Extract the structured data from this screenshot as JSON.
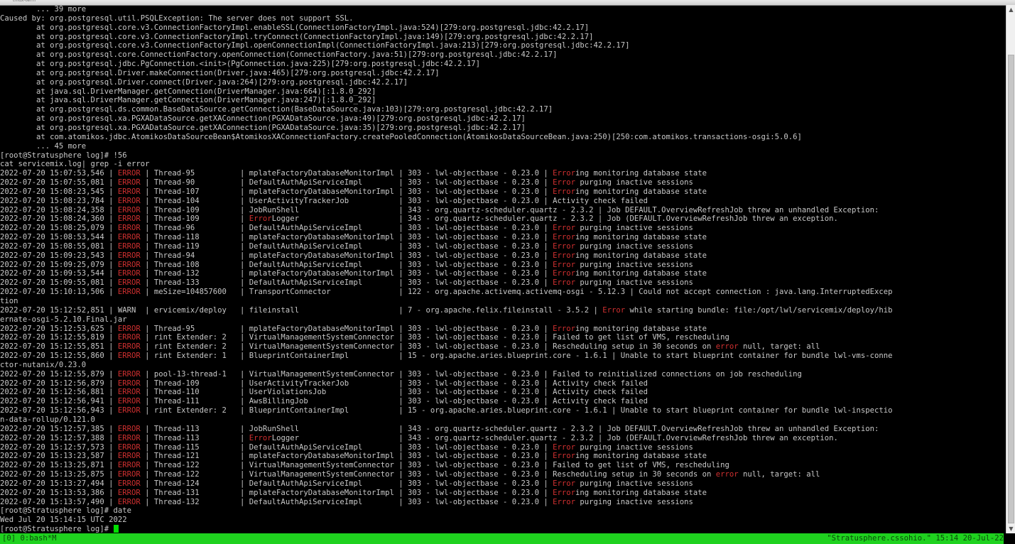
{
  "window": {
    "title": "tmux-term"
  },
  "terminal": {
    "lines": [
      {
        "segments": [
          {
            "text": "        ... 39 more"
          }
        ]
      },
      {
        "segments": [
          {
            "text": "Caused by: org.postgresql.util.PSQLException: The server does not support SSL."
          }
        ]
      },
      {
        "segments": [
          {
            "text": "        at org.postgresql.core.v3.ConnectionFactoryImpl.enableSSL(ConnectionFactoryImpl.java:524)[279:org.postgresql.jdbc:42.2.17]"
          }
        ]
      },
      {
        "segments": [
          {
            "text": "        at org.postgresql.core.v3.ConnectionFactoryImpl.tryConnect(ConnectionFactoryImpl.java:149)[279:org.postgresql.jdbc:42.2.17]"
          }
        ]
      },
      {
        "segments": [
          {
            "text": "        at org.postgresql.core.v3.ConnectionFactoryImpl.openConnectionImpl(ConnectionFactoryImpl.java:213)[279:org.postgresql.jdbc:42.2.17]"
          }
        ]
      },
      {
        "segments": [
          {
            "text": "        at org.postgresql.core.ConnectionFactory.openConnection(ConnectionFactory.java:51)[279:org.postgresql.jdbc:42.2.17]"
          }
        ]
      },
      {
        "segments": [
          {
            "text": "        at org.postgresql.jdbc.PgConnection.<init>(PgConnection.java:225)[279:org.postgresql.jdbc:42.2.17]"
          }
        ]
      },
      {
        "segments": [
          {
            "text": "        at org.postgresql.Driver.makeConnection(Driver.java:465)[279:org.postgresql.jdbc:42.2.17]"
          }
        ]
      },
      {
        "segments": [
          {
            "text": "        at org.postgresql.Driver.connect(Driver.java:264)[279:org.postgresql.jdbc:42.2.17]"
          }
        ]
      },
      {
        "segments": [
          {
            "text": "        at java.sql.DriverManager.getConnection(DriverManager.java:664)[:1.8.0_292]"
          }
        ]
      },
      {
        "segments": [
          {
            "text": "        at java.sql.DriverManager.getConnection(DriverManager.java:247)[:1.8.0_292]"
          }
        ]
      },
      {
        "segments": [
          {
            "text": "        at org.postgresql.ds.common.BaseDataSource.getConnection(BaseDataSource.java:103)[279:org.postgresql.jdbc:42.2.17]"
          }
        ]
      },
      {
        "segments": [
          {
            "text": "        at org.postgresql.xa.PGXADataSource.getXAConnection(PGXADataSource.java:49)[279:org.postgresql.jdbc:42.2.17]"
          }
        ]
      },
      {
        "segments": [
          {
            "text": "        at org.postgresql.xa.PGXADataSource.getXAConnection(PGXADataSource.java:35)[279:org.postgresql.jdbc:42.2.17]"
          }
        ]
      },
      {
        "segments": [
          {
            "text": "        at com.atomikos.jdbc.AtomikosDataSourceBean$AtomikosXAConnectionFactory.createPooledConnection(AtomikosDataSourceBean.java:250)[250:com.atomikos.transactions-osgi:5.0.6]"
          }
        ]
      },
      {
        "segments": [
          {
            "text": "        ... 45 more"
          }
        ]
      },
      {
        "segments": [
          {
            "text": "[root@Stratusphere log]# !56"
          }
        ]
      },
      {
        "segments": [
          {
            "text": "cat servicemix.log| grep -i error"
          }
        ]
      },
      {
        "segments": [
          {
            "text": "2022-07-20 15:07:53,546 | "
          },
          {
            "text": "ERROR",
            "err": true
          },
          {
            "text": " | Thread-95          | mplateFactoryDatabaseMonitorImpl | 303 - lwl-objectbase - 0.23.0 | "
          },
          {
            "text": "Error",
            "err": true
          },
          {
            "text": "ing monitoring database state"
          }
        ]
      },
      {
        "segments": [
          {
            "text": "2022-07-20 15:07:55,081 | "
          },
          {
            "text": "ERROR",
            "err": true
          },
          {
            "text": " | Thread-90          | DefaultAuthApiServiceImpl        | 303 - lwl-objectbase - 0.23.0 | "
          },
          {
            "text": "Error",
            "err": true
          },
          {
            "text": " purging inactive sessions"
          }
        ]
      },
      {
        "segments": [
          {
            "text": "2022-07-20 15:08:23,545 | "
          },
          {
            "text": "ERROR",
            "err": true
          },
          {
            "text": " | Thread-107         | mplateFactoryDatabaseMonitorImpl | 303 - lwl-objectbase - 0.23.0 | "
          },
          {
            "text": "Error",
            "err": true
          },
          {
            "text": "ing monitoring database state"
          }
        ]
      },
      {
        "segments": [
          {
            "text": "2022-07-20 15:08:23,784 | "
          },
          {
            "text": "ERROR",
            "err": true
          },
          {
            "text": " | Thread-104         | UserActivityTrackerJob           | 303 - lwl-objectbase - 0.23.0 | Activity check failed"
          }
        ]
      },
      {
        "segments": [
          {
            "text": "2022-07-20 15:08:24,358 | "
          },
          {
            "text": "ERROR",
            "err": true
          },
          {
            "text": " | Thread-109         | JobRunShell                      | 343 - org.quartz-scheduler.quartz - 2.3.2 | Job DEFAULT.OverviewRefreshJob threw an unhandled Exception:"
          }
        ]
      },
      {
        "segments": [
          {
            "text": "2022-07-20 15:08:24,360 | "
          },
          {
            "text": "ERROR",
            "err": true
          },
          {
            "text": " | Thread-109         | "
          },
          {
            "text": "Error",
            "err": true
          },
          {
            "text": "Logger                      | 343 - org.quartz-scheduler.quartz - 2.3.2 | Job (DEFAULT.OverviewRefreshJob threw an exception."
          }
        ]
      },
      {
        "segments": [
          {
            "text": "2022-07-20 15:08:25,079 | "
          },
          {
            "text": "ERROR",
            "err": true
          },
          {
            "text": " | Thread-96          | DefaultAuthApiServiceImpl        | 303 - lwl-objectbase - 0.23.0 | "
          },
          {
            "text": "Error",
            "err": true
          },
          {
            "text": " purging inactive sessions"
          }
        ]
      },
      {
        "segments": [
          {
            "text": "2022-07-20 15:08:53,544 | "
          },
          {
            "text": "ERROR",
            "err": true
          },
          {
            "text": " | Thread-118         | mplateFactoryDatabaseMonitorImpl | 303 - lwl-objectbase - 0.23.0 | "
          },
          {
            "text": "Error",
            "err": true
          },
          {
            "text": "ing monitoring database state"
          }
        ]
      },
      {
        "segments": [
          {
            "text": "2022-07-20 15:08:55,081 | "
          },
          {
            "text": "ERROR",
            "err": true
          },
          {
            "text": " | Thread-119         | DefaultAuthApiServiceImpl        | 303 - lwl-objectbase - 0.23.0 | "
          },
          {
            "text": "Error",
            "err": true
          },
          {
            "text": " purging inactive sessions"
          }
        ]
      },
      {
        "segments": [
          {
            "text": "2022-07-20 15:09:23,543 | "
          },
          {
            "text": "ERROR",
            "err": true
          },
          {
            "text": " | Thread-94          | mplateFactoryDatabaseMonitorImpl | 303 - lwl-objectbase - 0.23.0 | "
          },
          {
            "text": "Error",
            "err": true
          },
          {
            "text": "ing monitoring database state"
          }
        ]
      },
      {
        "segments": [
          {
            "text": "2022-07-20 15:09:25,079 | "
          },
          {
            "text": "ERROR",
            "err": true
          },
          {
            "text": " | Thread-108         | DefaultAuthApiServiceImpl        | 303 - lwl-objectbase - 0.23.0 | "
          },
          {
            "text": "Error",
            "err": true
          },
          {
            "text": " purging inactive sessions"
          }
        ]
      },
      {
        "segments": [
          {
            "text": "2022-07-20 15:09:53,544 | "
          },
          {
            "text": "ERROR",
            "err": true
          },
          {
            "text": " | Thread-132         | mplateFactoryDatabaseMonitorImpl | 303 - lwl-objectbase - 0.23.0 | "
          },
          {
            "text": "Error",
            "err": true
          },
          {
            "text": "ing monitoring database state"
          }
        ]
      },
      {
        "segments": [
          {
            "text": "2022-07-20 15:09:55,081 | "
          },
          {
            "text": "ERROR",
            "err": true
          },
          {
            "text": " | Thread-133         | DefaultAuthApiServiceImpl        | 303 - lwl-objectbase - 0.23.0 | "
          },
          {
            "text": "Error",
            "err": true
          },
          {
            "text": " purging inactive sessions"
          }
        ]
      },
      {
        "segments": [
          {
            "text": "2022-07-20 15:10:13,506 | "
          },
          {
            "text": "ERROR",
            "err": true
          },
          {
            "text": " | meSize=104857600   | TransportConnector               | 122 - org.apache.activemq.activemq-osgi - 5.12.3 | Could not accept connection : java.lang.InterruptedExcep"
          }
        ]
      },
      {
        "segments": [
          {
            "text": "tion"
          }
        ]
      },
      {
        "segments": [
          {
            "text": "2022-07-20 15:12:52,851 | WARN  | ervicemix/deploy   | fileinstall                      | 7 - org.apache.felix.fileinstall - 3.5.2 | "
          },
          {
            "text": "Error",
            "err": true
          },
          {
            "text": " while starting bundle: file:/opt/lwl/servicemix/deploy/hib"
          }
        ]
      },
      {
        "segments": [
          {
            "text": "ernate-osgi-5.2.10.Final.jar"
          }
        ]
      },
      {
        "segments": [
          {
            "text": "2022-07-20 15:12:53,625 | "
          },
          {
            "text": "ERROR",
            "err": true
          },
          {
            "text": " | Thread-95          | mplateFactoryDatabaseMonitorImpl | 303 - lwl-objectbase - 0.23.0 | "
          },
          {
            "text": "Error",
            "err": true
          },
          {
            "text": "ing monitoring database state"
          }
        ]
      },
      {
        "segments": [
          {
            "text": "2022-07-20 15:12:55,819 | "
          },
          {
            "text": "ERROR",
            "err": true
          },
          {
            "text": " | rint Extender: 2   | VirtualManagementSystemConnector | 303 - lwl-objectbase - 0.23.0 | Failed to get list of VMS, rescheduling"
          }
        ]
      },
      {
        "segments": [
          {
            "text": "2022-07-20 15:12:55,851 | "
          },
          {
            "text": "ERROR",
            "err": true
          },
          {
            "text": " | rint Extender: 2   | VirtualManagementSystemConnector | 303 - lwl-objectbase - 0.23.0 | Rescheduling setup in 30 seconds on "
          },
          {
            "text": "error",
            "err": true
          },
          {
            "text": " null, target: all"
          }
        ]
      },
      {
        "segments": [
          {
            "text": "2022-07-20 15:12:55,860 | "
          },
          {
            "text": "ERROR",
            "err": true
          },
          {
            "text": " | rint Extender: 1   | BlueprintContainerImpl           | 15 - org.apache.aries.blueprint.core - 1.6.1 | Unable to start blueprint container for bundle lwl-vms-conne"
          }
        ]
      },
      {
        "segments": [
          {
            "text": "ctor-nutanix/0.23.0"
          }
        ]
      },
      {
        "segments": [
          {
            "text": "2022-07-20 15:12:55,879 | "
          },
          {
            "text": "ERROR",
            "err": true
          },
          {
            "text": " | pool-13-thread-1   | VirtualManagementSystemConnector | 303 - lwl-objectbase - 0.23.0 | Failed to reinitialized connections on job rescheduling"
          }
        ]
      },
      {
        "segments": [
          {
            "text": "2022-07-20 15:12:56,879 | "
          },
          {
            "text": "ERROR",
            "err": true
          },
          {
            "text": " | Thread-109         | UserActivityTrackerJob           | 303 - lwl-objectbase - 0.23.0 | Activity check failed"
          }
        ]
      },
      {
        "segments": [
          {
            "text": "2022-07-20 15:12:56,881 | "
          },
          {
            "text": "ERROR",
            "err": true
          },
          {
            "text": " | Thread-110         | UserViolationsJob                | 303 - lwl-objectbase - 0.23.0 | Activity check failed"
          }
        ]
      },
      {
        "segments": [
          {
            "text": "2022-07-20 15:12:56,941 | "
          },
          {
            "text": "ERROR",
            "err": true
          },
          {
            "text": " | Thread-111         | AwsBillingJob                    | 303 - lwl-objectbase - 0.23.0 | Activity check failed"
          }
        ]
      },
      {
        "segments": [
          {
            "text": "2022-07-20 15:12:56,943 | "
          },
          {
            "text": "ERROR",
            "err": true
          },
          {
            "text": " | rint Extender: 2   | BlueprintContainerImpl           | 15 - org.apache.aries.blueprint.core - 1.6.1 | Unable to start blueprint container for bundle lwl-inspectio"
          }
        ]
      },
      {
        "segments": [
          {
            "text": "n-data-rollup/0.121.0"
          }
        ]
      },
      {
        "segments": [
          {
            "text": "2022-07-20 15:12:57,385 | "
          },
          {
            "text": "ERROR",
            "err": true
          },
          {
            "text": " | Thread-113         | JobRunShell                      | 343 - org.quartz-scheduler.quartz - 2.3.2 | Job DEFAULT.OverviewRefreshJob threw an unhandled Exception:"
          }
        ]
      },
      {
        "segments": [
          {
            "text": "2022-07-20 15:12:57,388 | "
          },
          {
            "text": "ERROR",
            "err": true
          },
          {
            "text": " | Thread-113         | "
          },
          {
            "text": "Error",
            "err": true
          },
          {
            "text": "Logger                      | 343 - org.quartz-scheduler.quartz - 2.3.2 | Job (DEFAULT.OverviewRefreshJob threw an exception."
          }
        ]
      },
      {
        "segments": [
          {
            "text": "2022-07-20 15:12:57,573 | "
          },
          {
            "text": "ERROR",
            "err": true
          },
          {
            "text": " | Thread-115         | DefaultAuthApiServiceImpl        | 303 - lwl-objectbase - 0.23.0 | "
          },
          {
            "text": "Error",
            "err": true
          },
          {
            "text": " purging inactive sessions"
          }
        ]
      },
      {
        "segments": [
          {
            "text": "2022-07-20 15:13:23,587 | "
          },
          {
            "text": "ERROR",
            "err": true
          },
          {
            "text": " | Thread-121         | mplateFactoryDatabaseMonitorImpl | 303 - lwl-objectbase - 0.23.0 | "
          },
          {
            "text": "Error",
            "err": true
          },
          {
            "text": "ing monitoring database state"
          }
        ]
      },
      {
        "segments": [
          {
            "text": "2022-07-20 15:13:25,871 | "
          },
          {
            "text": "ERROR",
            "err": true
          },
          {
            "text": " | Thread-122         | VirtualManagementSystemConnector | 303 - lwl-objectbase - 0.23.0 | Failed to get list of VMS, rescheduling"
          }
        ]
      },
      {
        "segments": [
          {
            "text": "2022-07-20 15:13:25,875 | "
          },
          {
            "text": "ERROR",
            "err": true
          },
          {
            "text": " | Thread-122         | VirtualManagementSystemConnector | 303 - lwl-objectbase - 0.23.0 | Rescheduling setup in 30 seconds on "
          },
          {
            "text": "error",
            "err": true
          },
          {
            "text": " null, target: all"
          }
        ]
      },
      {
        "segments": [
          {
            "text": "2022-07-20 15:13:27,494 | "
          },
          {
            "text": "ERROR",
            "err": true
          },
          {
            "text": " | Thread-124         | DefaultAuthApiServiceImpl        | 303 - lwl-objectbase - 0.23.0 | "
          },
          {
            "text": "Error",
            "err": true
          },
          {
            "text": " purging inactive sessions"
          }
        ]
      },
      {
        "segments": [
          {
            "text": "2022-07-20 15:13:53,386 | "
          },
          {
            "text": "ERROR",
            "err": true
          },
          {
            "text": " | Thread-131         | mplateFactoryDatabaseMonitorImpl | 303 - lwl-objectbase - 0.23.0 | "
          },
          {
            "text": "Error",
            "err": true
          },
          {
            "text": "ing monitoring database state"
          }
        ]
      },
      {
        "segments": [
          {
            "text": "2022-07-20 15:13:57,490 | "
          },
          {
            "text": "ERROR",
            "err": true
          },
          {
            "text": " | Thread-132         | DefaultAuthApiServiceImpl        | 303 - lwl-objectbase - 0.23.0 | "
          },
          {
            "text": "Error",
            "err": true
          },
          {
            "text": " purging inactive sessions"
          }
        ]
      },
      {
        "segments": [
          {
            "text": "[root@Stratusphere log]# date"
          }
        ]
      },
      {
        "segments": [
          {
            "text": "Wed Jul 20 15:14:15 UTC 2022"
          }
        ]
      }
    ],
    "prompt": "[root@Stratusphere log]# "
  },
  "statusbar": {
    "left": "[0] 0:bash*M",
    "right": "\"Stratusphere.cssohio.\" 15:14 20-Jul-22"
  },
  "colors": {
    "background": "#000000",
    "text": "#c8c8c8",
    "error": "#d03030",
    "status_bar": "#1fd21f",
    "cursor": "#00e000"
  },
  "scrollbar": {
    "up_icon": "▲",
    "down_icon": "▼"
  }
}
